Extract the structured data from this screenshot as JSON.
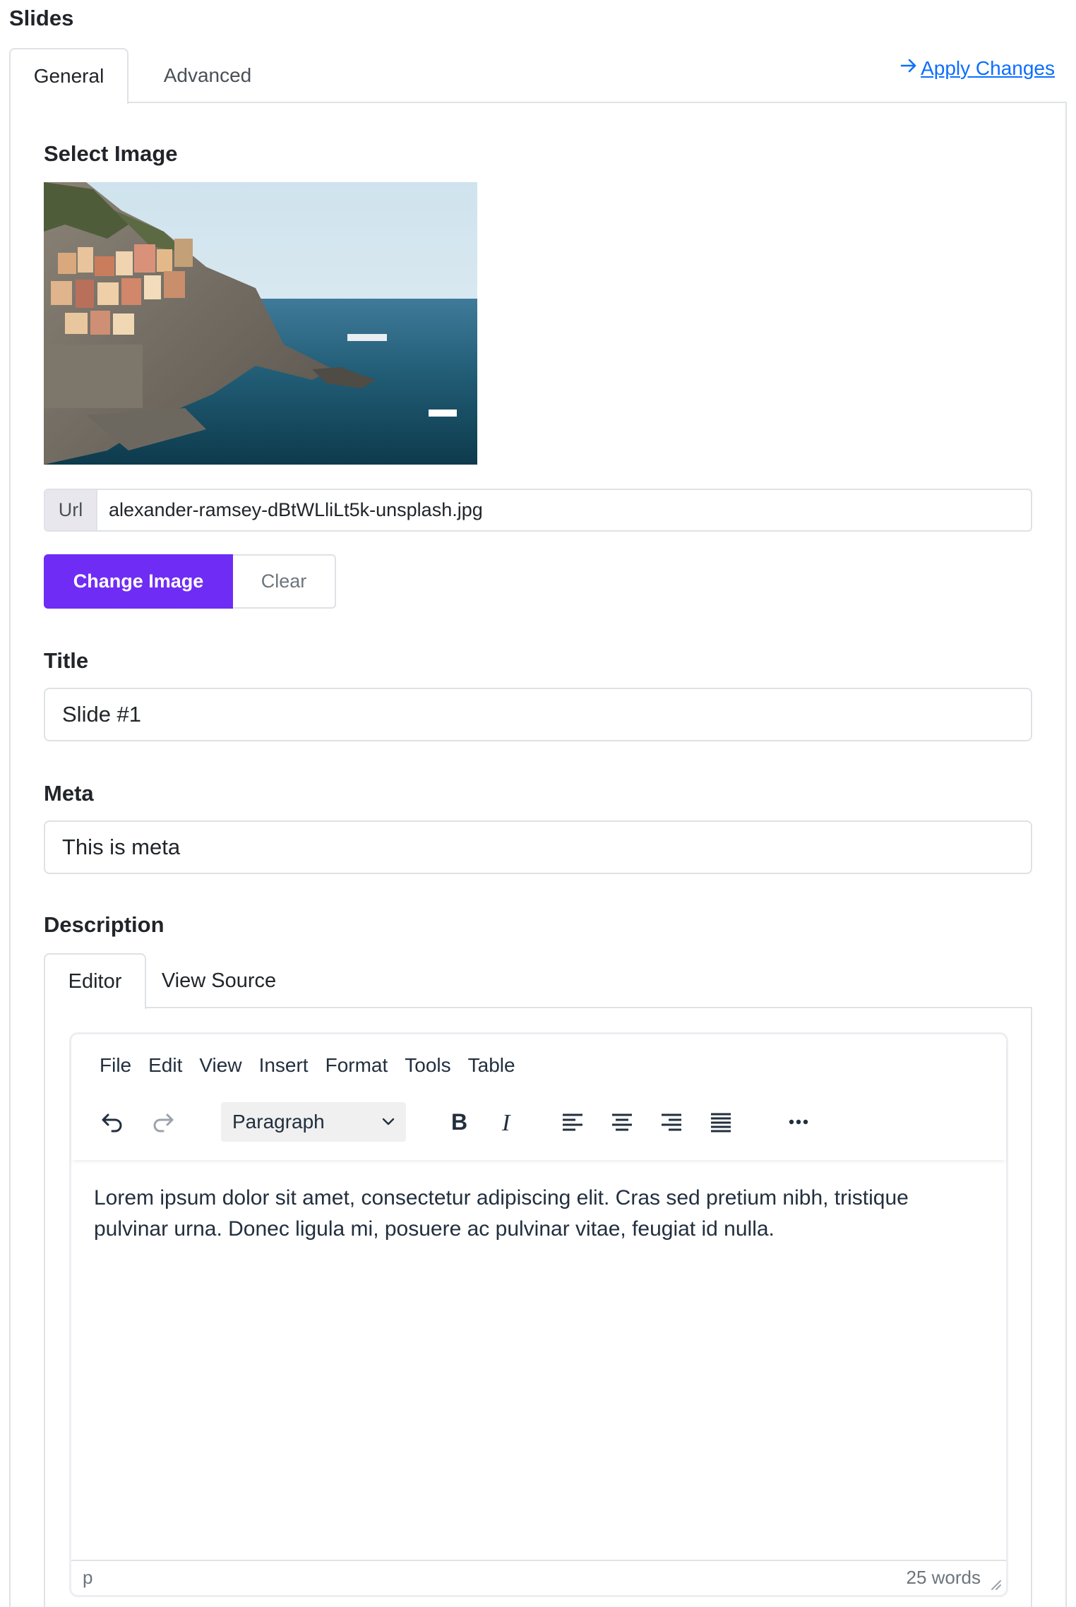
{
  "page": {
    "title": "Slides"
  },
  "tabs": [
    {
      "label": "General",
      "active": true
    },
    {
      "label": "Advanced",
      "active": false
    }
  ],
  "apply": {
    "label": "Apply Changes",
    "icon": "arrow-right-icon",
    "color": "#0d6efd"
  },
  "image_section": {
    "label": "Select Image",
    "url_prefix": "Url",
    "url_value": "alexander-ramsey-dBtWLliLt5k-unsplash.jpg",
    "change_button": "Change Image",
    "clear_button": "Clear",
    "accent": "#6f2cf5"
  },
  "title_field": {
    "label": "Title",
    "value": "Slide #1"
  },
  "meta_field": {
    "label": "Meta",
    "value": "This is meta"
  },
  "description": {
    "label": "Description",
    "tabs": [
      {
        "label": "Editor",
        "active": true
      },
      {
        "label": "View Source",
        "active": false
      }
    ],
    "menu": [
      "File",
      "Edit",
      "View",
      "Insert",
      "Format",
      "Tools",
      "Table"
    ],
    "toolbar": {
      "undo_icon": "undo-icon",
      "redo_icon": "redo-icon",
      "block_format": "Paragraph",
      "bold_icon": "bold-icon",
      "italic_icon": "italic-icon",
      "align_icons": [
        "align-left-icon",
        "align-center-icon",
        "align-right-icon",
        "align-justify-icon"
      ],
      "more_icon": "more-icon"
    },
    "content": "Lorem ipsum dolor sit amet, consectetur adipiscing elit. Cras sed pretium nibh, tristique pulvinar urna. Donec ligula mi, posuere ac pulvinar vitae, feugiat id nulla.",
    "status_path": "p",
    "word_count": "25 words"
  }
}
